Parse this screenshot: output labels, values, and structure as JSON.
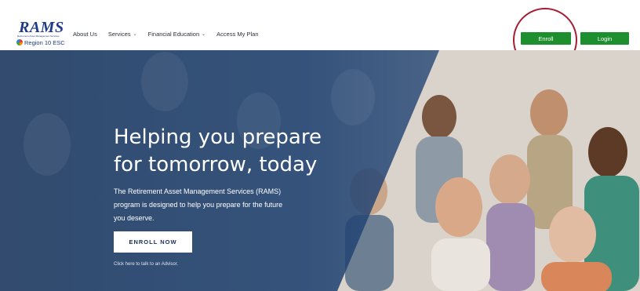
{
  "logo": {
    "title": "RAMS",
    "subtitle": "Retirement Asset Management Services",
    "org": "Region 10 ESC"
  },
  "nav": {
    "items": [
      {
        "label": "About Us",
        "has_dropdown": false
      },
      {
        "label": "Services",
        "has_dropdown": true
      },
      {
        "label": "Financial Education",
        "has_dropdown": true
      },
      {
        "label": "Access My Plan",
        "has_dropdown": false
      }
    ]
  },
  "header_buttons": {
    "enroll_label": "Enroll",
    "login_label": "Login"
  },
  "hero": {
    "title_lines": [
      "Helping you prepare",
      "for tomorrow, today"
    ],
    "description_lines": [
      "The Retirement Asset Management Services (RAMS)",
      "program is designed to help you prepare for the future",
      "you deserve."
    ],
    "cta_label": "ENROLL NOW",
    "advisor_link": "Click here to talk to an Advisor."
  },
  "colors": {
    "brand_blue": "#1f3a8a",
    "button_green": "#1e8f2e",
    "hero_overlay": "#1b3a66",
    "annotation_circle": "#a41e34"
  },
  "icons": {
    "dropdown": "chevron-down-icon",
    "logo_mark": "region-swirl-icon"
  }
}
